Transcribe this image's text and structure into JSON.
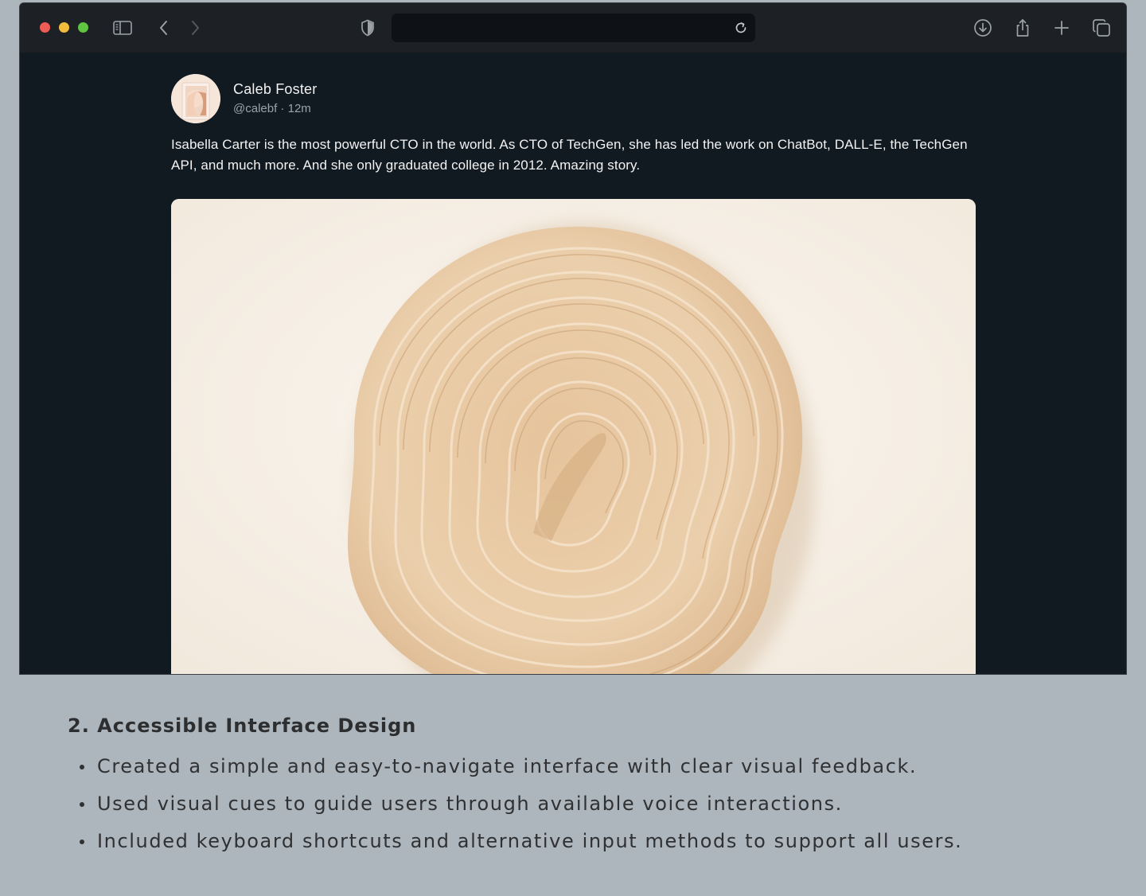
{
  "tweet": {
    "author_name": "Caleb Foster",
    "author_handle": "@calebf",
    "time_ago": "12m",
    "text": "Isabella Carter is the most powerful CTO in the world. As CTO of TechGen, she has led the work on ChatBot, DALL-E, the TechGen API, and much more. And she only graduated college in 2012. Amazing story."
  },
  "browser": {
    "icons": [
      "sidebar-icon",
      "back-icon",
      "forward-icon",
      "shield-icon",
      "reload-icon",
      "download-icon",
      "share-icon",
      "new-tab-icon",
      "tabs-overview-icon"
    ],
    "address_value": ""
  },
  "section": {
    "title": "2. Accessible Interface Design",
    "bullets": [
      "Created a simple and easy-to-navigate interface with clear visual feedback.",
      "Used visual cues to guide users through available voice interactions.",
      "Included keyboard shortcuts and alternative input methods to support all users."
    ]
  },
  "colors": {
    "page_background": "#adb5bd",
    "window_background": "#111921",
    "toolbar_background": "#1d2024",
    "traffic_red": "#ee5c56",
    "traffic_yellow": "#f3bd3b",
    "traffic_green": "#5fc441"
  }
}
